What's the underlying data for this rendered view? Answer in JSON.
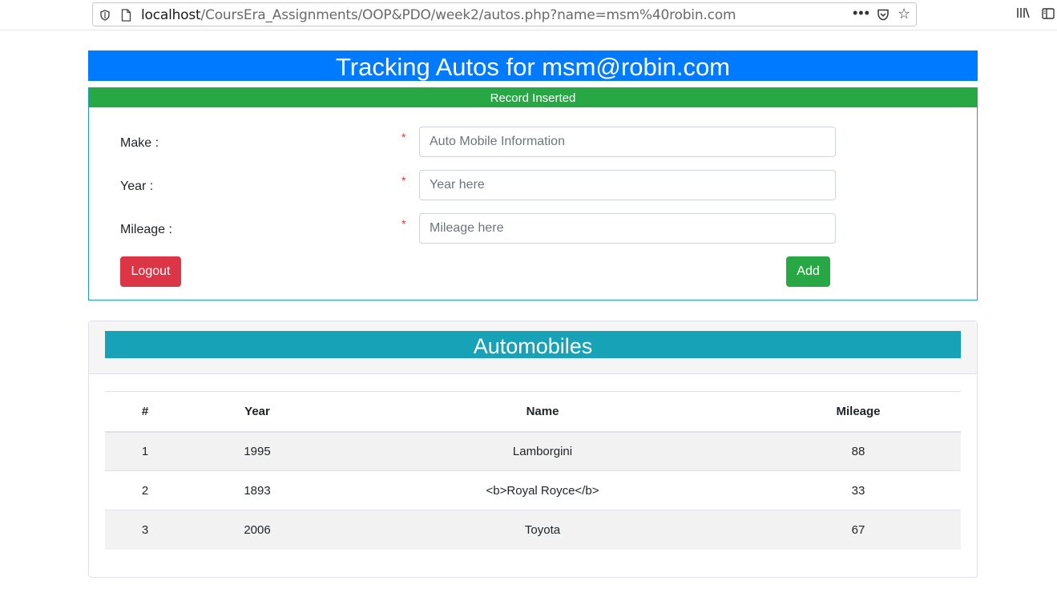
{
  "browser": {
    "url_host": "localhost",
    "url_path": "/CoursEra_Assignments/OOP&PDO/week2/autos.php?name=msm%40robin.com",
    "more_label": "•••"
  },
  "header": {
    "title": "Tracking Autos for msm@robin.com"
  },
  "alert": {
    "message": "Record Inserted",
    "color": "#28a745"
  },
  "form": {
    "make_label": "Make :",
    "make_placeholder": "Auto Mobile Information",
    "year_label": "Year :",
    "year_placeholder": "Year here",
    "mileage_label": "Mileage :",
    "mileage_placeholder": "Mileage here",
    "required_mark": "*",
    "logout_label": "Logout",
    "add_label": "Add"
  },
  "automobiles": {
    "title": "Automobiles",
    "columns": [
      "#",
      "Year",
      "Name",
      "Mileage"
    ],
    "rows": [
      {
        "num": "1",
        "year": "1995",
        "name": "Lamborgini",
        "mileage": "88"
      },
      {
        "num": "2",
        "year": "1893",
        "name": "<b>Royal Royce</b>",
        "mileage": "33"
      },
      {
        "num": "3",
        "year": "2006",
        "name": "Toyota",
        "mileage": "67"
      }
    ]
  },
  "colors": {
    "primary": "#007bff",
    "info": "#17a2b8",
    "success": "#28a745",
    "danger": "#dc3545"
  }
}
